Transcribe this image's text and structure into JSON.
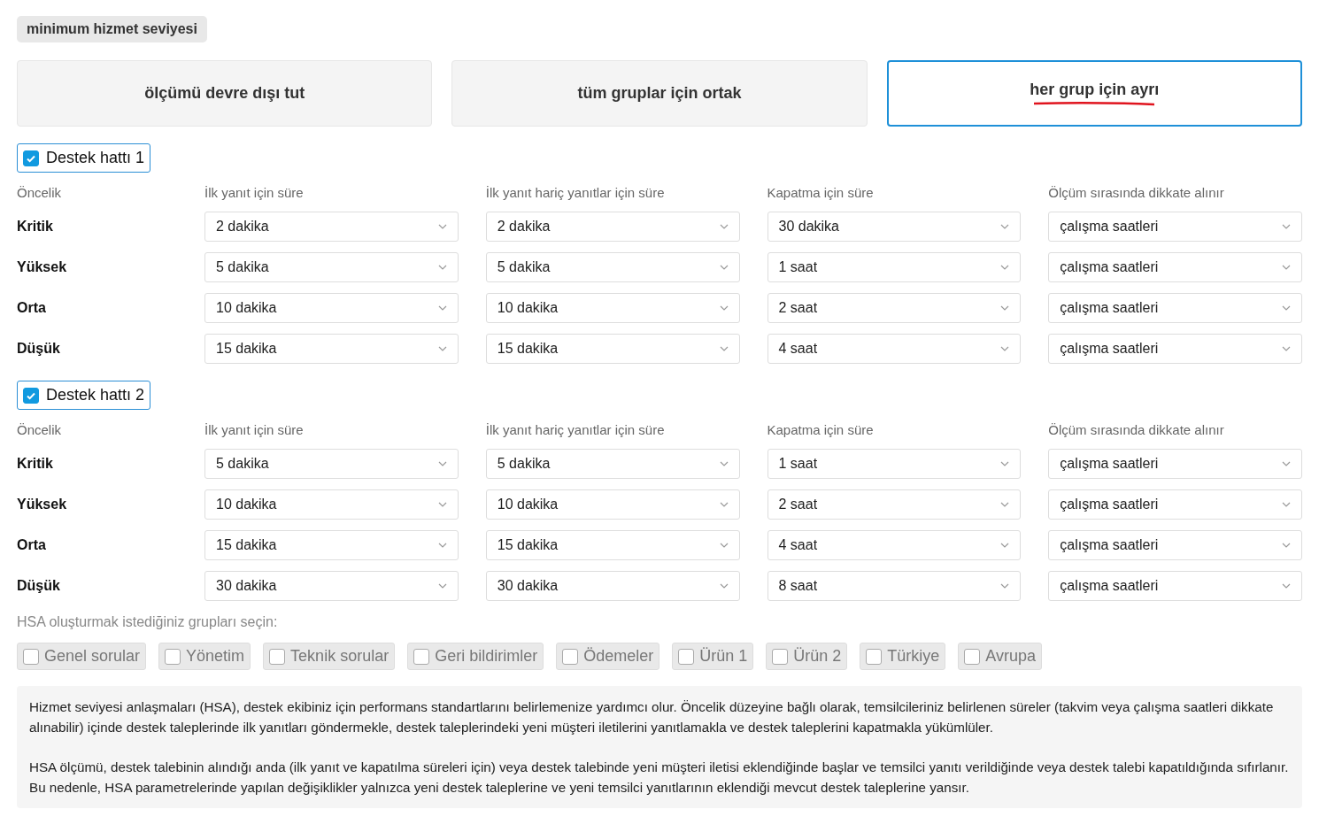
{
  "section_label": "minimum hizmet seviyesi",
  "modes": [
    {
      "label": "ölçümü devre dışı tut",
      "selected": false
    },
    {
      "label": "tüm gruplar için ortak",
      "selected": false
    },
    {
      "label": "her grup için ayrı",
      "selected": true
    }
  ],
  "groups": [
    {
      "name": "Destek hattı 1",
      "checked": true,
      "columns": [
        "Öncelik",
        "İlk yanıt için süre",
        "İlk yanıt hariç yanıtlar için süre",
        "Kapatma için süre",
        "Ölçüm sırasında dikkate alınır"
      ],
      "rows": [
        {
          "priority": "Kritik",
          "values": [
            "2 dakika",
            "2 dakika",
            "30 dakika",
            "çalışma saatleri"
          ]
        },
        {
          "priority": "Yüksek",
          "values": [
            "5 dakika",
            "5 dakika",
            "1 saat",
            "çalışma saatleri"
          ]
        },
        {
          "priority": "Orta",
          "values": [
            "10 dakika",
            "10 dakika",
            "2 saat",
            "çalışma saatleri"
          ]
        },
        {
          "priority": "Düşük",
          "values": [
            "15 dakika",
            "15 dakika",
            "4 saat",
            "çalışma saatleri"
          ]
        }
      ]
    },
    {
      "name": "Destek hattı 2",
      "checked": true,
      "columns": [
        "Öncelik",
        "İlk yanıt için süre",
        "İlk yanıt hariç yanıtlar için süre",
        "Kapatma için süre",
        "Ölçüm sırasında dikkate alınır"
      ],
      "rows": [
        {
          "priority": "Kritik",
          "values": [
            "5 dakika",
            "5 dakika",
            "1 saat",
            "çalışma saatleri"
          ]
        },
        {
          "priority": "Yüksek",
          "values": [
            "10 dakika",
            "10 dakika",
            "2 saat",
            "çalışma saatleri"
          ]
        },
        {
          "priority": "Orta",
          "values": [
            "15 dakika",
            "15 dakika",
            "4 saat",
            "çalışma saatleri"
          ]
        },
        {
          "priority": "Düşük",
          "values": [
            "30 dakika",
            "30 dakika",
            "8 saat",
            "çalışma saatleri"
          ]
        }
      ]
    }
  ],
  "group_picker": {
    "label": "HSA oluşturmak istediğiniz grupları seçin:",
    "options": [
      {
        "label": "Genel sorular",
        "checked": false
      },
      {
        "label": "Yönetim",
        "checked": false
      },
      {
        "label": "Teknik sorular",
        "checked": false
      },
      {
        "label": "Geri bildirimler",
        "checked": false
      },
      {
        "label": "Ödemeler",
        "checked": false
      },
      {
        "label": "Ürün 1",
        "checked": false
      },
      {
        "label": "Ürün 2",
        "checked": false
      },
      {
        "label": "Türkiye",
        "checked": false
      },
      {
        "label": "Avrupa",
        "checked": false
      }
    ]
  },
  "info": [
    "Hizmet seviyesi anlaşmaları (HSA), destek ekibiniz için performans standartlarını belirlemenize yardımcı olur. Öncelik düzeyine bağlı olarak, temsilcileriniz belirlenen süreler (takvim veya çalışma saatleri dikkate alınabilir) içinde destek taleplerinde ilk yanıtları göndermekle, destek taleplerindeki yeni müşteri iletilerini yanıtlamakla ve destek taleplerini kapatmakla yükümlüler.",
    "HSA ölçümü, destek talebinin alındığı anda (ilk yanıt ve kapatılma süreleri için) veya destek talebinde yeni müşteri iletisi eklendiğinde başlar ve temsilci yanıtı verildiğinde veya destek talebi kapatıldığında sıfırlanır. Bu nedenle, HSA parametrelerinde yapılan değişiklikler yalnızca yeni destek taleplerine ve yeni temsilci yanıtlarının eklendiği mevcut destek taleplerine yansır."
  ]
}
